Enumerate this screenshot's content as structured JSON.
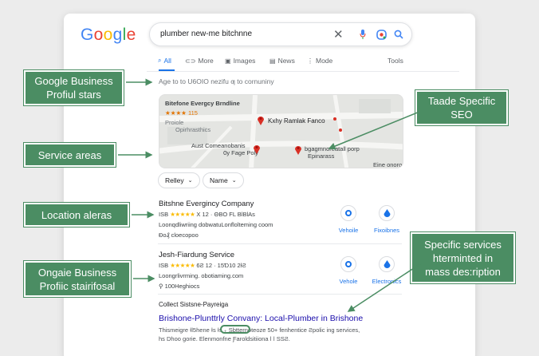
{
  "logo": {
    "letters": [
      "G",
      "o",
      "o",
      "g",
      "l",
      "e"
    ],
    "colors": [
      "#4285f4",
      "#ea4335",
      "#fbbc04",
      "#4285f4",
      "#34a853",
      "#ea4335"
    ]
  },
  "search": {
    "query": "plumber new-me bitchnne"
  },
  "tabs": [
    {
      "label": "All",
      "icon": "search-icon"
    },
    {
      "label": "More",
      "icon": "link-icon"
    },
    {
      "label": "Images",
      "icon": "image-icon"
    },
    {
      "label": "News",
      "icon": "news-icon"
    },
    {
      "label": "Mode",
      "icon": "more-vert-icon"
    },
    {
      "label": "Tools",
      "icon": ""
    }
  ],
  "age_line": "Age to to U6OIO nezifu ƣ to cornuniny",
  "map": {
    "labels": {
      "title": "Bitefone Evergcy Brndline",
      "rating": "★★★★ 115",
      "sub1": "Proiole",
      "sub2": "Opirhrasthics",
      "pin1": "Kxhy Ramlak Fanco",
      "street1": "Aust Comeanobanis",
      "street2": "Ѹ Fage Poly",
      "pin2_line1": "bgagmnoreatall porp",
      "pin2_line2": "Epinarass",
      "corner": "Eine onoro"
    }
  },
  "chips": [
    {
      "label": "Relley"
    },
    {
      "label": "Name"
    }
  ],
  "listings": [
    {
      "name": "Bitshne Evergincy Company",
      "rating_prefix": "ISB",
      "stars": "★★★★★",
      "rating_suffix": "X 12 · ΘBO FL BlBlAs",
      "line2": "Loonqdliwriing dobwatuLonflolteming coom",
      "line3": "Ɖo₰ cloecopoo",
      "actions": [
        {
          "label": "Vehoile",
          "icon": "target-icon"
        },
        {
          "label": "Fixoibnes",
          "icon": "drop-icon"
        }
      ]
    },
    {
      "name": "Jesh-Fiardung Service",
      "rating_prefix": "ISB",
      "stars": "★★★★★",
      "rating_suffix": "6Ƨ 12 · 15Ɗ10 2ƗƧ",
      "line2": "Loongrlivrming. obotiaming.com",
      "line3": "100Heghiocs",
      "actions": [
        {
          "label": "Vehole",
          "icon": "target-icon"
        },
        {
          "label": "Electronics",
          "icon": "drop-icon"
        }
      ]
    }
  ],
  "organic": {
    "source": "Collect Sistsne-Payreiga",
    "title": "Brishone-Plunttrly Convany: Local-Plumber in Brishone",
    "snippet1": "Thismeigre Ɨl5hene   Ɨs Ɨs   ₊ Sbtternoteoze 50+ fenhentice Ƨpolic ing services,",
    "snippet2": "hs Dhoo gorie. Elenmonfne Ƒaroldsitiiona ǀ ǀ SSƧ."
  },
  "callouts": {
    "gbp_stars": [
      "Google Business",
      "Profiul stars"
    ],
    "service_areas": [
      "Service areas"
    ],
    "location": [
      "Location aleras"
    ],
    "ongaie": [
      "Ongaie Business",
      "Profiic stairifosal"
    ],
    "trade": [
      "Taade Specific",
      "SEO"
    ],
    "services": [
      "Specific services",
      "hterminted in",
      "mass des:ription"
    ]
  },
  "colors": {
    "callout_green": "#4b8d63",
    "link_blue": "#1a0dab",
    "accent_blue": "#1a73e8",
    "star_yellow": "#fbbc04",
    "pin_red": "#d93025"
  }
}
